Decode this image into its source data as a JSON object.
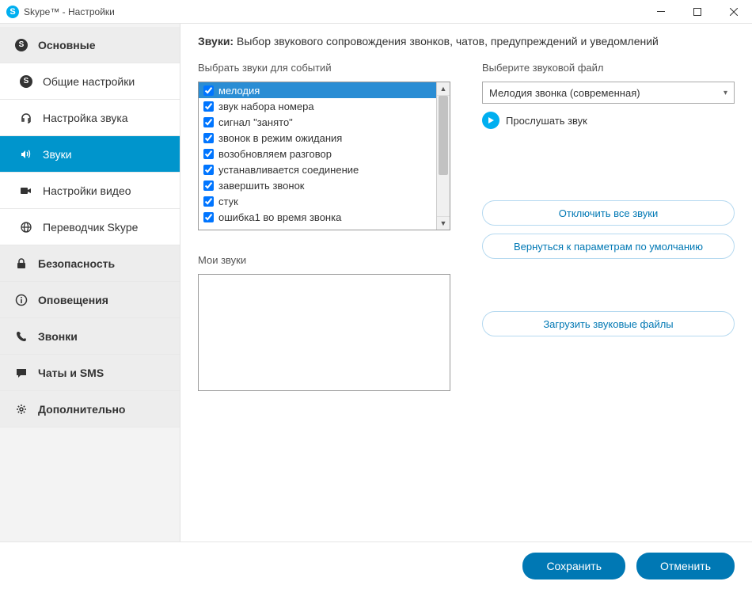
{
  "window": {
    "title": "Skype™ - Настройки"
  },
  "sidebar": {
    "sections": [
      {
        "label": "Основные",
        "icon": "skype",
        "type": "header"
      },
      {
        "label": "Общие настройки",
        "icon": "skype",
        "type": "sub"
      },
      {
        "label": "Настройка звука",
        "icon": "headset",
        "type": "sub"
      },
      {
        "label": "Звуки",
        "icon": "speaker",
        "type": "sub",
        "active": true
      },
      {
        "label": "Настройки видео",
        "icon": "camera",
        "type": "sub"
      },
      {
        "label": "Переводчик Skype",
        "icon": "globe",
        "type": "sub"
      },
      {
        "label": "Безопасность",
        "icon": "lock",
        "type": "header"
      },
      {
        "label": "Оповещения",
        "icon": "info",
        "type": "header"
      },
      {
        "label": "Звонки",
        "icon": "phone",
        "type": "header"
      },
      {
        "label": "Чаты и SMS",
        "icon": "chat",
        "type": "header"
      },
      {
        "label": "Дополнительно",
        "icon": "gear",
        "type": "header"
      }
    ]
  },
  "page": {
    "title_bold": "Звуки:",
    "title_rest": " Выбор звукового сопровождения звонков, чатов, предупреждений и уведомлений",
    "events_label": "Выбрать звуки для событий",
    "file_label": "Выберите звуковой файл",
    "events": [
      {
        "label": "мелодия",
        "checked": true,
        "selected": true
      },
      {
        "label": "звук набора номера",
        "checked": true
      },
      {
        "label": "сигнал \"занято\"",
        "checked": true
      },
      {
        "label": "звонок в режим ожидания",
        "checked": true
      },
      {
        "label": "возобновляем разговор",
        "checked": true
      },
      {
        "label": "устанавливается соединение",
        "checked": true
      },
      {
        "label": "завершить звонок",
        "checked": true
      },
      {
        "label": "стук",
        "checked": true
      },
      {
        "label": "ошибка1 во время звонка",
        "checked": true
      }
    ],
    "dropdown_value": "Мелодия звонка (современная)",
    "play_label": "Прослушать звук",
    "disable_all": "Отключить все звуки",
    "reset_defaults": "Вернуться к параметрам по умолчанию",
    "my_sounds_label": "Мои звуки",
    "upload_label": "Загрузить звуковые файлы"
  },
  "footer": {
    "save": "Сохранить",
    "cancel": "Отменить"
  }
}
